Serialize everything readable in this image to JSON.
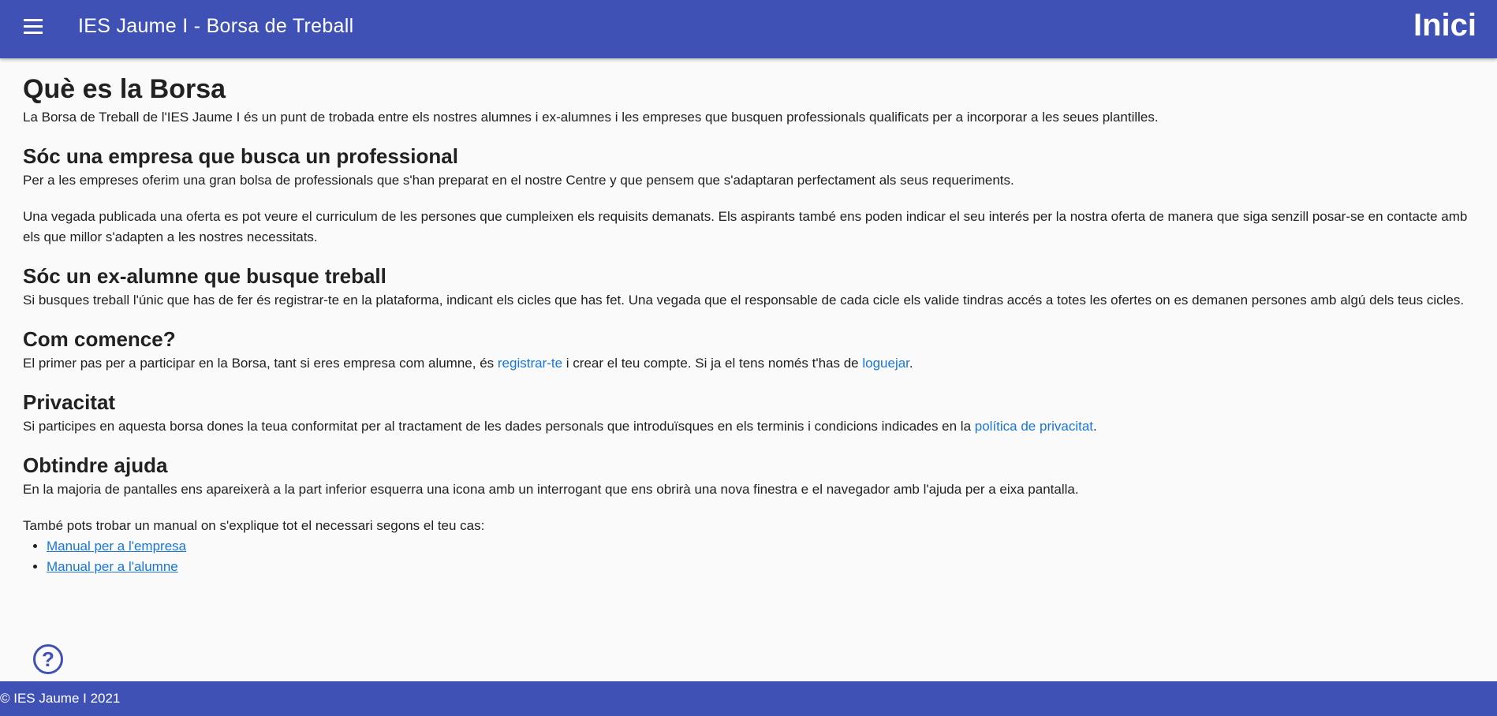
{
  "header": {
    "title": "IES Jaume I - Borsa de Treball",
    "page_link": "Inici"
  },
  "content": {
    "s1": {
      "heading": "Què es la Borsa",
      "p1": "La Borsa de Treball de l'IES Jaume I és un punt de trobada entre els nostres alumnes i ex-alumnes i les empreses que busquen professionals qualificats per a incorporar a les seues plantilles."
    },
    "s2": {
      "heading": "Sóc una empresa que busca un professional",
      "p1": "Per a les empreses oferim una gran bolsa de professionals que s'han preparat en el nostre Centre y que pensem que s'adaptaran perfectament als seus requeriments.",
      "p2": "Una vegada publicada una oferta es pot veure el curriculum de les persones que cumpleixen els requisits demanats. Els aspirants també ens poden indicar el seu interés per la nostra oferta de manera que siga senzill posar-se en contacte amb els que millor s'adapten a les nostres necessitats."
    },
    "s3": {
      "heading": "Sóc un ex-alumne que busque treball",
      "p1": "Si busques treball l'únic que has de fer és registrar-te en la plataforma, indicant els cicles que has fet. Una vegada que el responsable de cada cicle els valide tindras accés a totes les ofertes on es demanen persones amb algú dels teus cicles."
    },
    "s4": {
      "heading": "Com comence?",
      "t1": "El primer pas per a participar en la Borsa, tant si eres empresa com alumne, és ",
      "link1": "registrar-te",
      "t2": " i crear el teu compte. Si ja el tens només t'has de ",
      "link2": "loguejar",
      "t3": "."
    },
    "s5": {
      "heading": "Privacitat",
      "t1": "Si participes en aquesta borsa dones la teua conformitat per al tractament de les dades personals que introduïsques en els terminis i condicions indicades en la ",
      "link1": "política de privacitat",
      "t2": "."
    },
    "s6": {
      "heading": "Obtindre ajuda",
      "p1": "En la majoria de pantalles ens apareixerà a la part inferior esquerra una icona amb un interrogant que ens obrirà una nova finestra e el navegador amb l'ajuda per a eixa pantalla.",
      "p2": "També pots trobar un manual on s'explique tot el necessari segons el teu cas:",
      "manuals": [
        "Manual per a l'empresa",
        "Manual per a l'alumne"
      ]
    }
  },
  "help": {
    "icon": "help-circle-icon",
    "glyph": "?"
  },
  "footer": {
    "text": "© IES Jaume I 2021"
  },
  "colors": {
    "primary": "#3f51b5",
    "link": "#1976d2"
  }
}
